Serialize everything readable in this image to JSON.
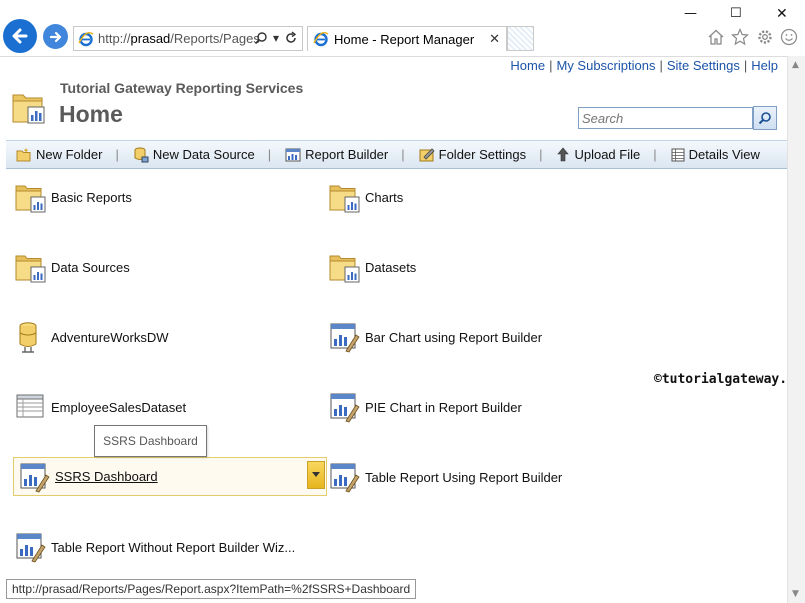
{
  "browser": {
    "address_protocol": "http://",
    "address_host": "prasad",
    "address_path": "/Reports/Pages",
    "tab_title": "Home - Report Manager"
  },
  "top_links": [
    "Home",
    "My Subscriptions",
    "Site Settings",
    "Help"
  ],
  "site_title": "Tutorial Gateway Reporting Services",
  "page_title": "Home",
  "search": {
    "placeholder": "Search"
  },
  "toolbar": [
    {
      "label": "New Folder",
      "icon": "new-folder-icon"
    },
    {
      "label": "New Data Source",
      "icon": "new-data-source-icon"
    },
    {
      "label": "Report Builder",
      "icon": "report-builder-icon"
    },
    {
      "label": "Folder Settings",
      "icon": "folder-settings-icon"
    },
    {
      "label": "Upload File",
      "icon": "upload-file-icon"
    },
    {
      "label": "Details View",
      "icon": "details-view-icon"
    }
  ],
  "items": [
    {
      "label": "Basic Reports",
      "icon": "folder-icon"
    },
    {
      "label": "Charts",
      "icon": "folder-icon"
    },
    {
      "label": "Data Sources",
      "icon": "folder-icon"
    },
    {
      "label": "Datasets",
      "icon": "folder-icon"
    },
    {
      "label": "AdventureWorksDW",
      "icon": "data-source-icon"
    },
    {
      "label": "Bar Chart using Report Builder",
      "icon": "report-icon"
    },
    {
      "label": "EmployeeSalesDataset",
      "icon": "dataset-icon"
    },
    {
      "label": "PIE Chart in Report Builder",
      "icon": "report-icon"
    },
    {
      "label": "SSRS Dashboard",
      "icon": "report-icon",
      "selected": true
    },
    {
      "label": "Table Report Using Report Builder",
      "icon": "report-icon"
    },
    {
      "label": "Table Report Without Report Builder Wiz...",
      "icon": "report-icon"
    }
  ],
  "tooltip": "SSRS Dashboard",
  "watermark": "©tutorialgateway.org",
  "status_url": "http://prasad/Reports/Pages/Report.aspx?ItemPath=%2fSSRS+Dashboard"
}
